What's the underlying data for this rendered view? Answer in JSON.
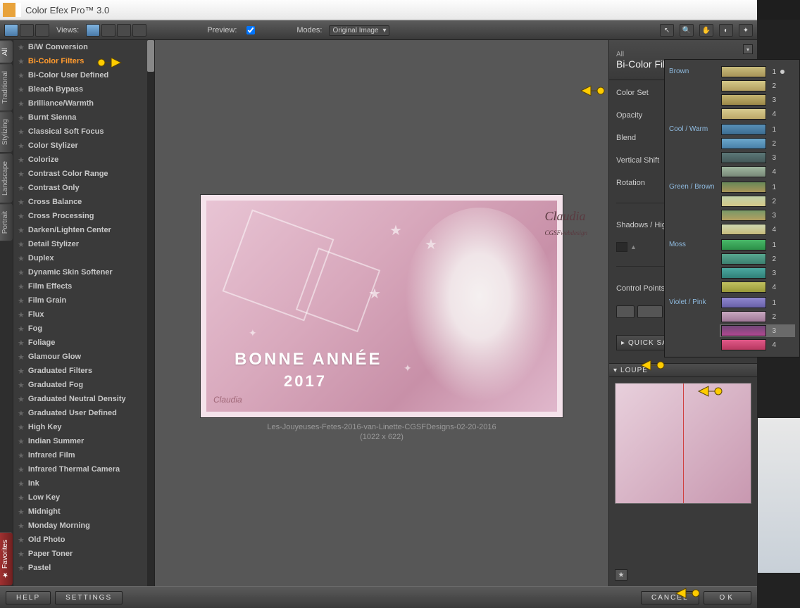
{
  "title": "Color Efex Pro™ 3.0",
  "toolbar": {
    "views": "Views:",
    "preview": "Preview:",
    "modes": "Modes:",
    "mode_value": "Original Image"
  },
  "vtabs": [
    "All",
    "Traditional",
    "Stylizing",
    "Landscape",
    "Portrait"
  ],
  "vtab_fav": "Favorites",
  "filters": [
    "B/W Conversion",
    "Bi-Color Filters",
    "Bi-Color User Defined",
    "Bleach Bypass",
    "Brilliance/Warmth",
    "Burnt Sienna",
    "Classical Soft Focus",
    "Color Stylizer",
    "Colorize",
    "Contrast Color Range",
    "Contrast Only",
    "Cross Balance",
    "Cross Processing",
    "Darken/Lighten Center",
    "Detail Stylizer",
    "Duplex",
    "Dynamic Skin Softener",
    "Film Effects",
    "Film Grain",
    "Flux",
    "Fog",
    "Foliage",
    "Glamour Glow",
    "Graduated Filters",
    "Graduated Fog",
    "Graduated Neutral Density",
    "Graduated User Defined",
    "High Key",
    "Indian Summer",
    "Infrared Film",
    "Infrared Thermal Camera",
    "Ink",
    "Low Key",
    "Midnight",
    "Monday Morning",
    "Old Photo",
    "Paper Toner",
    "Pastel"
  ],
  "selected_filter": 1,
  "preview_caption": "Les-Jouyeuses-Fetes-2016-van-Linette-CGSFDesigns-02-20-2016",
  "preview_dims": "(1022 x 622)",
  "art_text": "BONNE ANNÉE",
  "art_year": "2017",
  "art_sig": "Claudia",
  "art_sig2": "Claudia",
  "art_sig2b": "CGSFwebdesign",
  "panel": {
    "head_small": "All",
    "head_big": "Bi-Color Filters",
    "rows": [
      "Color Set",
      "Opacity",
      "Blend",
      "Vertical Shift",
      "Rotation"
    ],
    "swatch_value": "1",
    "shadow": "Shadows / Highli",
    "cpoints": "Control Points",
    "quicksave": "QUICK SAVE",
    "loupe": "LOUPE"
  },
  "dropdown": {
    "groups": [
      {
        "name": "Brown",
        "swatches": [
          [
            "#c8bc7c",
            "#a89458"
          ],
          [
            "#d4c888",
            "#b4a060"
          ],
          [
            "#c4b470",
            "#9c8848"
          ],
          [
            "#d8cc90",
            "#bca868"
          ]
        ],
        "selected": 0
      },
      {
        "name": "Cool / Warm",
        "swatches": [
          [
            "#5890b8",
            "#3c6c90"
          ],
          [
            "#6ca8cc",
            "#4880a8"
          ],
          [
            "#5c7878",
            "#445858"
          ],
          [
            "#a0b8a0",
            "#788878"
          ]
        ]
      },
      {
        "name": "Green / Brown",
        "swatches": [
          [
            "#688858",
            "#a89458"
          ],
          [
            "#c0d0a8",
            "#d4c888"
          ],
          [
            "#789868",
            "#b4a060"
          ],
          [
            "#d0d8b0",
            "#c8bc7c"
          ]
        ]
      },
      {
        "name": "Moss",
        "swatches": [
          [
            "#48b868",
            "#2c9048"
          ],
          [
            "#58a890",
            "#3c8070"
          ],
          [
            "#4ca8a0",
            "#308078"
          ],
          [
            "#c0c060",
            "#989838"
          ]
        ]
      },
      {
        "name": "Violet / Pink",
        "swatches": [
          [
            "#9088d0",
            "#6860a8"
          ],
          [
            "#c8a8c0",
            "#a07898"
          ],
          [
            "#704878",
            "#b04890"
          ],
          [
            "#e05888",
            "#b83860"
          ]
        ],
        "highlight": 2
      }
    ]
  },
  "footer": {
    "help": "HELP",
    "settings": "SETTINGS",
    "cancel": "CANCEL",
    "ok": "OK"
  }
}
